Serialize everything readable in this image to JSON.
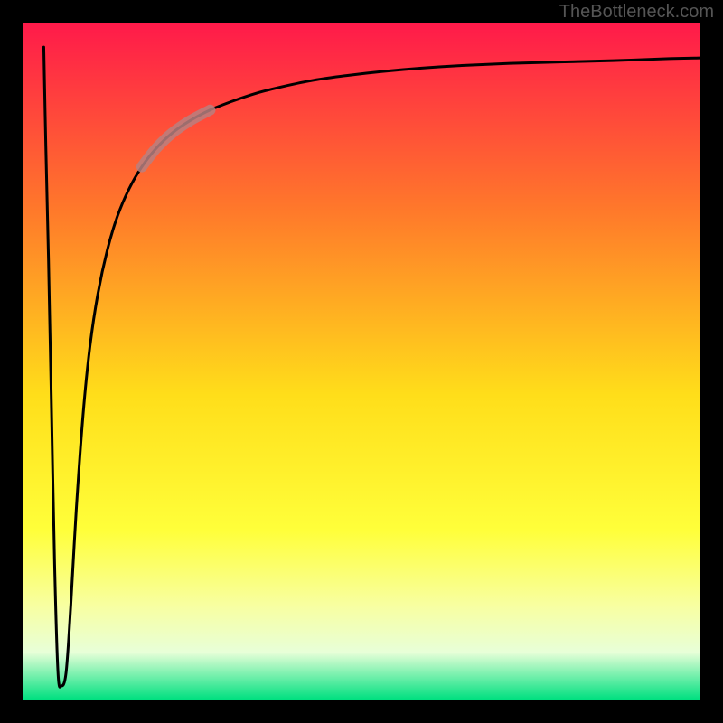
{
  "attribution": "TheBottleneck.com",
  "colors": {
    "frame": "#000000",
    "gradient_top": "#ff1a4a",
    "gradient_mid1": "#ff7a2a",
    "gradient_mid2": "#ffde1a",
    "gradient_mid3": "#ffff3a",
    "gradient_mid4": "#f8ffa0",
    "gradient_mid5": "#e8ffd8",
    "gradient_bottom": "#00e080",
    "curve": "#000000",
    "highlight": "#b98080"
  },
  "chart_data": {
    "type": "line",
    "title": "",
    "xlabel": "",
    "ylabel": "",
    "xlim": [
      0,
      100
    ],
    "ylim": [
      0,
      100
    ],
    "series": [
      {
        "name": "curve",
        "x": [
          3.0,
          3.3,
          3.7,
          4.1,
          4.6,
          5.1,
          5.6,
          6.3,
          7.0,
          7.8,
          8.8,
          9.8,
          11.0,
          12.4,
          13.9,
          15.6,
          17.5,
          19.6,
          22.0,
          24.6,
          27.6,
          30.9,
          34.5,
          38.5,
          42.9,
          47.8,
          53.1,
          58.9,
          65.2,
          72.0,
          79.3,
          87.2,
          95.5,
          100.0
        ],
        "y": [
          96.5,
          82.0,
          65.0,
          45.0,
          20.0,
          4.0,
          2.0,
          4.0,
          14.0,
          28.0,
          42.0,
          52.0,
          60.0,
          66.5,
          71.5,
          75.5,
          78.8,
          81.5,
          83.8,
          85.6,
          87.2,
          88.5,
          89.7,
          90.7,
          91.6,
          92.3,
          92.9,
          93.4,
          93.8,
          94.1,
          94.3,
          94.5,
          94.8,
          94.9
        ]
      }
    ],
    "highlight_segment": {
      "x": [
        17.5,
        19.6,
        22.0,
        24.6,
        27.6
      ],
      "y": [
        78.8,
        81.5,
        83.8,
        85.6,
        87.2
      ]
    }
  }
}
